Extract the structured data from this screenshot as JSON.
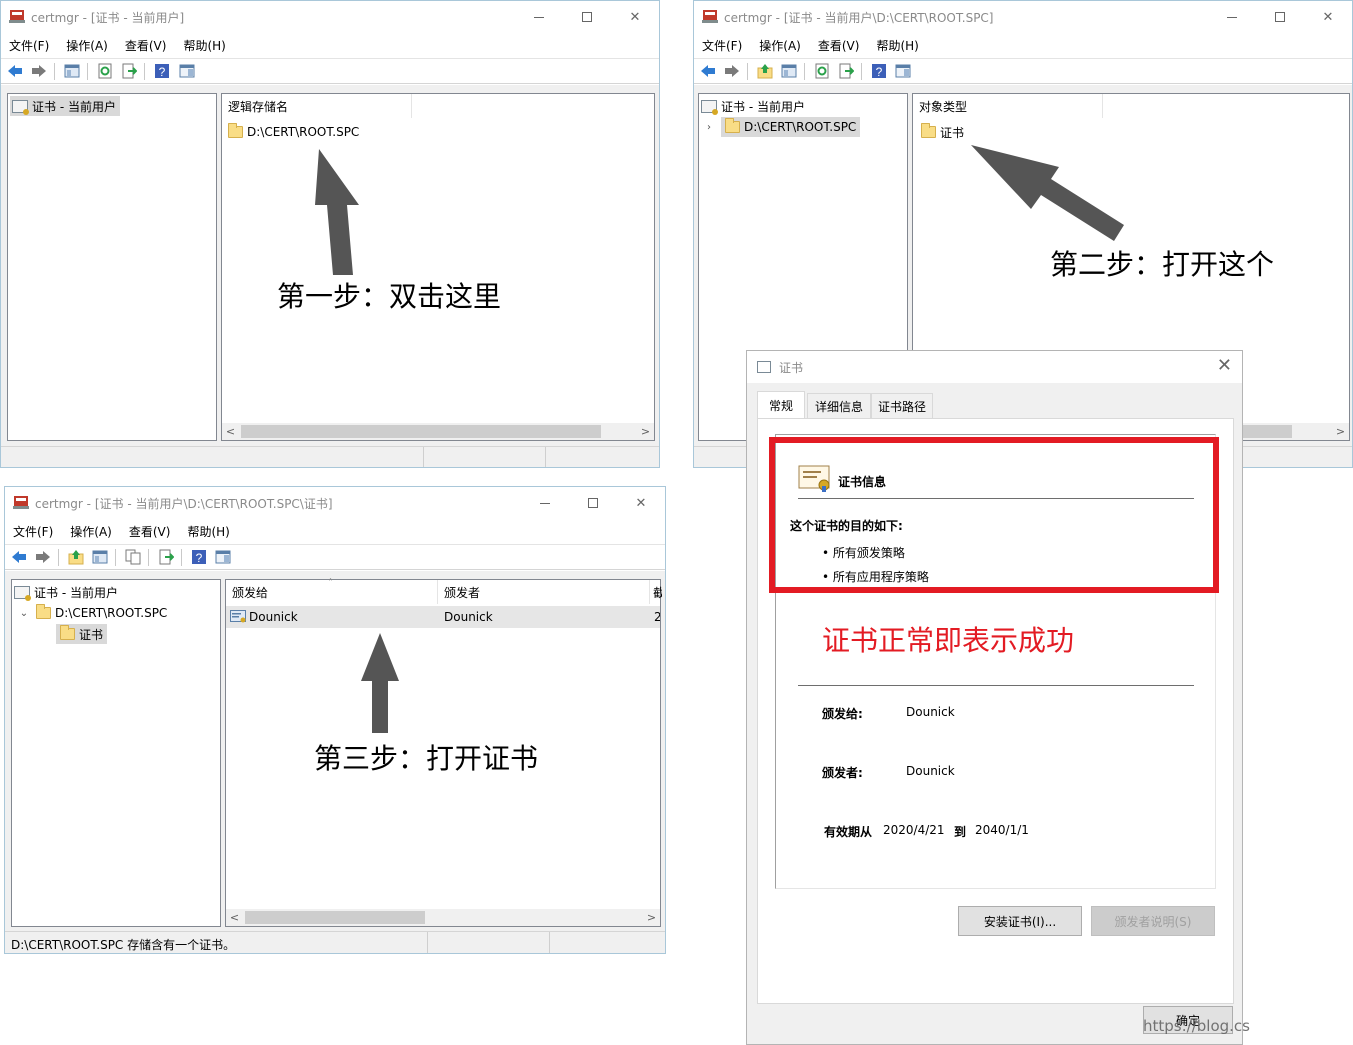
{
  "menu": [
    "文件(F)",
    "操作(A)",
    "查看(V)",
    "帮助(H)"
  ],
  "win1": {
    "title": "certmgr - [证书 - 当前用户]",
    "tree_root": "证书 - 当前用户",
    "column_header": "逻辑存储名",
    "item": "D:\\CERT\\ROOT.SPC",
    "annotation": "第一步：双击这里"
  },
  "win2": {
    "title": "certmgr - [证书 - 当前用户\\D:\\CERT\\ROOT.SPC]",
    "tree_root": "证书 - 当前用户",
    "tree_child": "D:\\CERT\\ROOT.SPC",
    "column_header": "对象类型",
    "item": "证书",
    "annotation": "第二步：打开这个"
  },
  "win3": {
    "title": "certmgr - [证书 - 当前用户\\D:\\CERT\\ROOT.SPC\\证书]",
    "tree_root": "证书 - 当前用户",
    "tree_child": "D:\\CERT\\ROOT.SPC",
    "tree_grandchild": "证书",
    "col_issued_to": "颁发给",
    "col_issued_by": "颁发者",
    "col_third": "截",
    "row_issued_to": "Dounick",
    "row_issued_by": "Dounick",
    "row_third": "2",
    "annotation": "第三步：打开证书",
    "status": "D:\\CERT\\ROOT.SPC 存储含有一个证书。"
  },
  "dialog": {
    "title": "证书",
    "tabs": [
      "常规",
      "详细信息",
      "证书路径"
    ],
    "info_heading": "证书信息",
    "purpose_heading": "这个证书的目的如下:",
    "purposes": [
      "• 所有颁发策略",
      "• 所有应用程序策略"
    ],
    "success_note": "证书正常即表示成功",
    "issued_to_label": "颁发给:",
    "issued_to_value": "Dounick",
    "issued_by_label": "颁发者:",
    "issued_by_value": "Dounick",
    "validity_from_label": "有效期从",
    "validity_from": "2020/4/21",
    "validity_to_label": "到",
    "validity_to": "2040/1/1",
    "install_button": "安装证书(I)...",
    "issuer_statement_button": "颁发者说明(S)",
    "ok_button": "确定",
    "watermark": "https://blog.cs"
  },
  "colors": {
    "annotation_red": "#e31b23",
    "arrow_gray": "#555555"
  }
}
